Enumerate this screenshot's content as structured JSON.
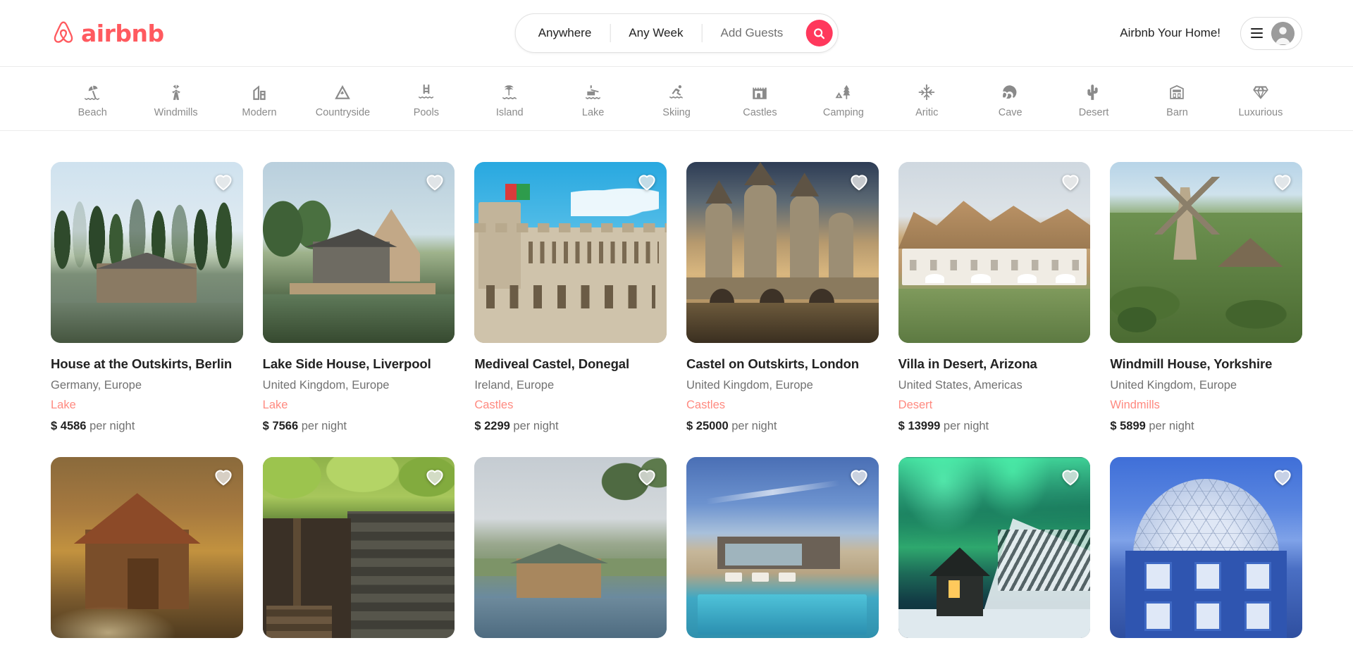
{
  "header": {
    "logo_text": "airbnb",
    "logo_icon": "airbnb-bellhop-icon",
    "search": {
      "location": "Anywhere",
      "dates": "Any Week",
      "guests": "Add Guests",
      "search_icon": "search-icon"
    },
    "host_link": "Airbnb Your Home!",
    "menu_icon": "hamburger-menu-icon",
    "avatar_icon": "user-avatar-icon"
  },
  "categories": [
    {
      "label": "Beach",
      "icon": "beach-umbrella-icon"
    },
    {
      "label": "Windmills",
      "icon": "windmill-icon"
    },
    {
      "label": "Modern",
      "icon": "modern-building-icon"
    },
    {
      "label": "Countryside",
      "icon": "mountain-icon"
    },
    {
      "label": "Pools",
      "icon": "pool-ladder-icon"
    },
    {
      "label": "Island",
      "icon": "island-palm-icon"
    },
    {
      "label": "Lake",
      "icon": "lake-fishing-icon"
    },
    {
      "label": "Skiing",
      "icon": "skier-icon"
    },
    {
      "label": "Castles",
      "icon": "castle-icon"
    },
    {
      "label": "Camping",
      "icon": "camping-tent-tree-icon"
    },
    {
      "label": "Aritic",
      "icon": "snowflake-icon"
    },
    {
      "label": "Cave",
      "icon": "cave-icon"
    },
    {
      "label": "Desert",
      "icon": "cactus-icon"
    },
    {
      "label": "Barn",
      "icon": "barn-icon"
    },
    {
      "label": "Luxurious",
      "icon": "diamond-icon"
    }
  ],
  "listings": [
    {
      "title": "House at the Outskirts, Berlin",
      "location": "Germany, Europe",
      "category": "Lake",
      "currency": "$",
      "price": "4586",
      "price_suffix": "per night",
      "favorite_icon": "heart-icon",
      "scene": "s1"
    },
    {
      "title": "Lake Side House, Liverpool",
      "location": "United Kingdom, Europe",
      "category": "Lake",
      "currency": "$",
      "price": "7566",
      "price_suffix": "per night",
      "favorite_icon": "heart-icon",
      "scene": "s2"
    },
    {
      "title": "Mediveal Castel, Donegal",
      "location": "Ireland, Europe",
      "category": "Castles",
      "currency": "$",
      "price": "2299",
      "price_suffix": "per night",
      "favorite_icon": "heart-icon",
      "scene": "s3"
    },
    {
      "title": "Castel on Outskirts, London",
      "location": "United Kingdom, Europe",
      "category": "Castles",
      "currency": "$",
      "price": "25000",
      "price_suffix": "per night",
      "favorite_icon": "heart-icon",
      "scene": "s4"
    },
    {
      "title": "Villa in Desert, Arizona",
      "location": "United States, Americas",
      "category": "Desert",
      "currency": "$",
      "price": "13999",
      "price_suffix": "per night",
      "favorite_icon": "heart-icon",
      "scene": "s5"
    },
    {
      "title": "Windmill House, Yorkshire",
      "location": "United Kingdom, Europe",
      "category": "Windmills",
      "currency": "$",
      "price": "5899",
      "price_suffix": "per night",
      "favorite_icon": "heart-icon",
      "scene": "s6"
    },
    {
      "title": "",
      "location": "",
      "category": "",
      "currency": "",
      "price": "",
      "price_suffix": "",
      "favorite_icon": "heart-icon",
      "scene": "s7"
    },
    {
      "title": "",
      "location": "",
      "category": "",
      "currency": "",
      "price": "",
      "price_suffix": "",
      "favorite_icon": "heart-icon",
      "scene": "s8"
    },
    {
      "title": "",
      "location": "",
      "category": "",
      "currency": "",
      "price": "",
      "price_suffix": "",
      "favorite_icon": "heart-icon",
      "scene": "s9"
    },
    {
      "title": "",
      "location": "",
      "category": "",
      "currency": "",
      "price": "",
      "price_suffix": "",
      "favorite_icon": "heart-icon",
      "scene": "s10"
    },
    {
      "title": "",
      "location": "",
      "category": "",
      "currency": "",
      "price": "",
      "price_suffix": "",
      "favorite_icon": "heart-icon",
      "scene": "s11"
    },
    {
      "title": "",
      "location": "",
      "category": "",
      "currency": "",
      "price": "",
      "price_suffix": "",
      "favorite_icon": "heart-icon",
      "scene": "s12"
    }
  ],
  "colors": {
    "brand": "#FF5A5F",
    "search_button": "#FF385C",
    "category_text": "#FF8A80",
    "muted_text": "#717171",
    "primary_text": "#222222"
  }
}
